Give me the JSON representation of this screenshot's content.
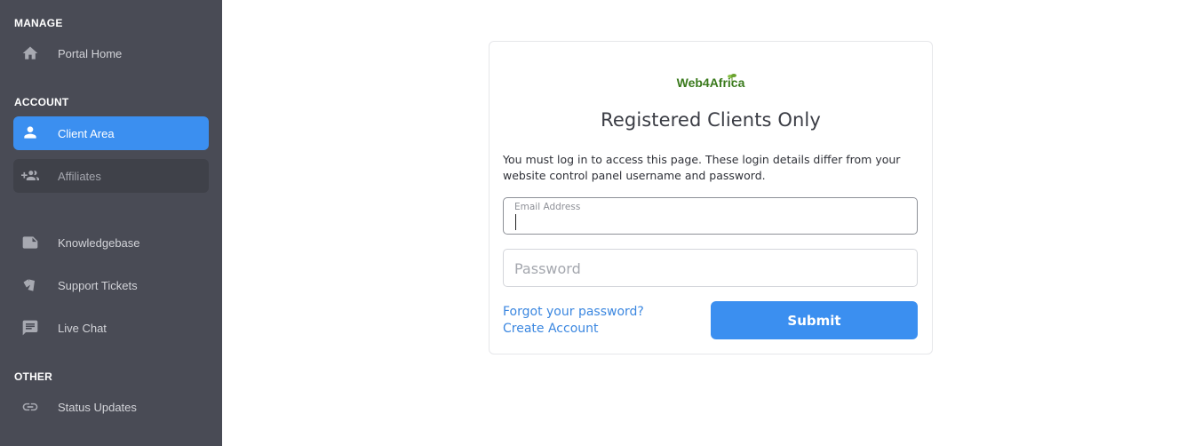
{
  "sidebar": {
    "sections": {
      "manage": "MANAGE",
      "account": "ACCOUNT",
      "other": "OTHER"
    },
    "items": {
      "portal_home": "Portal Home",
      "client_area": "Client Area",
      "affiliates": "Affiliates",
      "knowledgebase": "Knowledgebase",
      "support_tickets": "Support Tickets",
      "live_chat": "Live Chat",
      "status_updates": "Status Updates"
    },
    "active_item": "client_area",
    "icons": {
      "portal_home": "home-icon",
      "client_area": "person-icon",
      "affiliates": "group-add-icon",
      "knowledgebase": "note-icon",
      "support_tickets": "tickets-icon",
      "live_chat": "chat-icon",
      "status_updates": "link-icon"
    }
  },
  "login": {
    "logo_text": "Web4Africa",
    "title": "Registered Clients Only",
    "info": "You must log in to access this page. These login details differ from your website control panel username and password.",
    "email_label": "Email Address",
    "email_value": "",
    "password_placeholder": "Password",
    "password_value": "",
    "forgot_link": "Forgot your password?",
    "create_link": "Create Account",
    "submit_label": "Submit"
  },
  "colors": {
    "sidebar_bg": "#494b55",
    "accent": "#3b8ff0",
    "link": "#3b87e0",
    "logo_green": "#3a7a1c"
  }
}
